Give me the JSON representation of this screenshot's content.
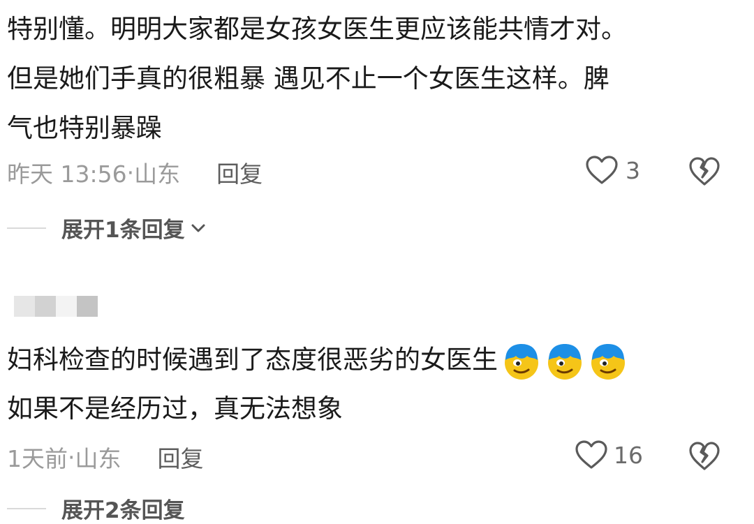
{
  "comment1": {
    "lines": [
      "特别懂。明明大家都是女孩女医生更应该能共情才对。",
      "但是她们手真的很粗暴 遇见不止一个女医生这样。脾",
      "气也特别暴躁"
    ],
    "time": "昨天 13:56",
    "location": "山东",
    "reply_label": "回复",
    "like_count": "3",
    "expand_label": "展开1条回复"
  },
  "comment2": {
    "username": "",
    "lines": [
      "妇科检查的时候遇到了态度很恶劣的女医生",
      "如果不是经历过，真无法想象"
    ],
    "emojis": [
      "cool-face-emoji",
      "cool-face-emoji",
      "cool-face-emoji"
    ],
    "time": "1天前",
    "location": "山东",
    "reply_label": "回复",
    "like_count": "16",
    "expand_label": "展开2条回复"
  },
  "icons": {
    "like": "heart-outline-icon",
    "dislike": "broken-heart-icon",
    "expand": "chevron-down-icon"
  },
  "colors": {
    "text": "#1a1a1a",
    "meta": "#9a9a9a",
    "reply": "#5d5d5d",
    "icon": "#6b6b6b"
  }
}
